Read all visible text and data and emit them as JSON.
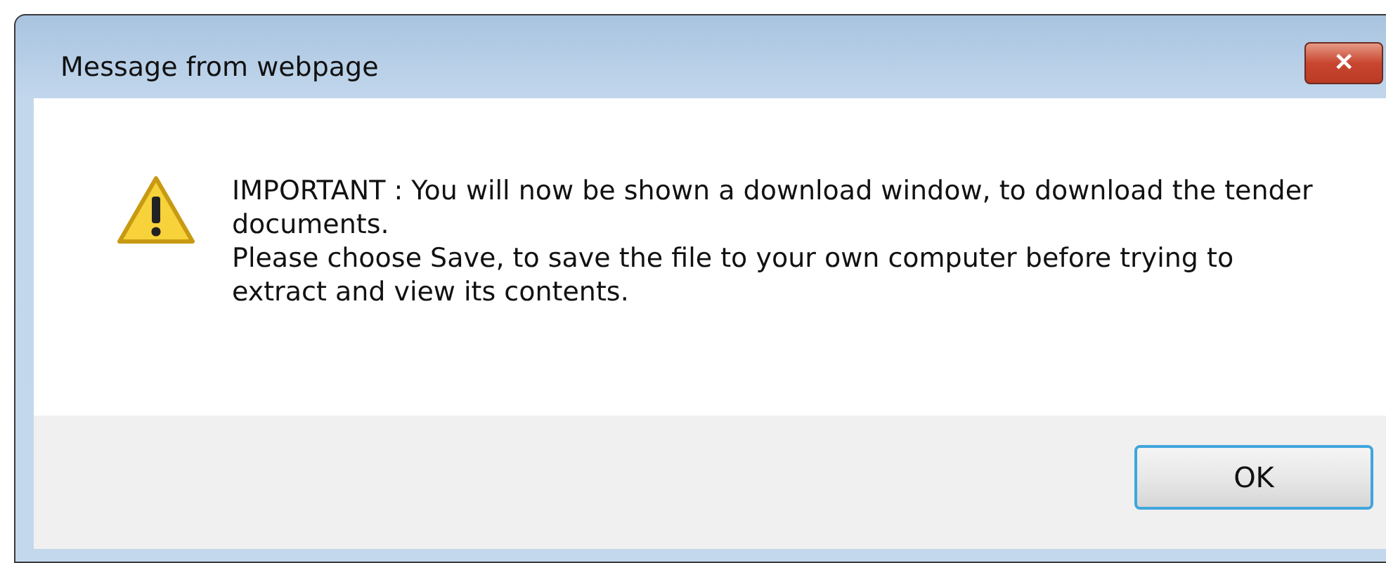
{
  "window": {
    "title": "Message from webpage",
    "close": "✕"
  },
  "message": [
    "IMPORTANT : You will now be shown a download window, to download the tender documents.",
    "Please choose Save, to save the file to your own computer before trying to extract and view its contents."
  ],
  "buttons": [
    {
      "label": "OK",
      "focused": true
    }
  ]
}
